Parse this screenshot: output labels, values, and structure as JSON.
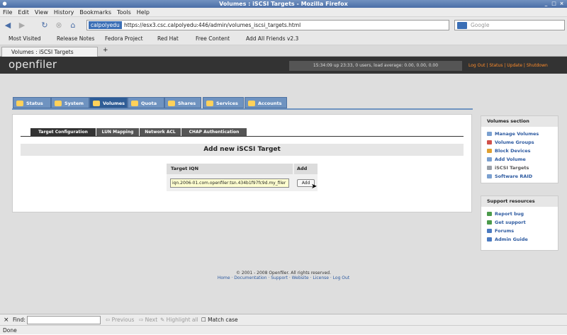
{
  "window": {
    "title": "Volumes : iSCSI Targets - Mozilla Firefox"
  },
  "menu": [
    "File",
    "Edit",
    "View",
    "History",
    "Bookmarks",
    "Tools",
    "Help"
  ],
  "navigation": {
    "url_identity": "calpolyedu",
    "url": "https://esx3.csc.calpolyedu:446/admin/volumes_iscsi_targets.html",
    "search_placeholder": "Google"
  },
  "bookmarks": [
    "Most Visited",
    "Release Notes",
    "Fedora Project",
    "Red Hat",
    "Free Content",
    "Add All Friends v2.3"
  ],
  "browser_tab": {
    "label": "Volumes : iSCSI Targets"
  },
  "openfiler": {
    "logo": "openfiler",
    "status_text": "15:34:09 up 23:33, 0 users, load average: 0.00, 0.00, 0.00",
    "top_links": "Log Out | Status | Update | Shutdown"
  },
  "main_tabs": [
    {
      "label": "Status"
    },
    {
      "label": "System"
    },
    {
      "label": "Volumes",
      "active": true
    },
    {
      "label": "Quota"
    },
    {
      "label": "Shares"
    },
    {
      "label": "Services"
    },
    {
      "label": "Accounts"
    }
  ],
  "sub_tabs": [
    {
      "label": "Target Configuration",
      "active": true
    },
    {
      "label": "LUN Mapping"
    },
    {
      "label": "Network ACL"
    },
    {
      "label": "CHAP Authentication"
    }
  ],
  "form": {
    "heading": "Add new iSCSI Target",
    "col_iqn": "Target IQN",
    "col_add": "Add",
    "iqn_value": "iqn.2006-01.com.openfiler:tsn.434b1f97fc9d.my_filer",
    "add_button": "Add"
  },
  "volumes_section": {
    "title": "Volumes section",
    "items": [
      "Manage Volumes",
      "Volume Groups",
      "Block Devices",
      "Add Volume",
      "iSCSI Targets",
      "Software RAID"
    ]
  },
  "support_section": {
    "title": "Support resources",
    "items": [
      "Report bug",
      "Get support",
      "Forums",
      "Admin Guide"
    ]
  },
  "footer": {
    "copyright": "© 2001 - 2008 Openfiler. All rights reserved.",
    "links": "Home · Documentation · Support · Website · License · Log Out"
  },
  "findbar": {
    "label": "Find:",
    "previous": "Previous",
    "next": "Next",
    "highlight": "Highlight all",
    "match_case": "Match case"
  },
  "statusbar": {
    "text": "Done"
  },
  "colors": {
    "accent": "#2f5d96",
    "orange": "#ff8c2a",
    "header_bg": "#333333"
  }
}
